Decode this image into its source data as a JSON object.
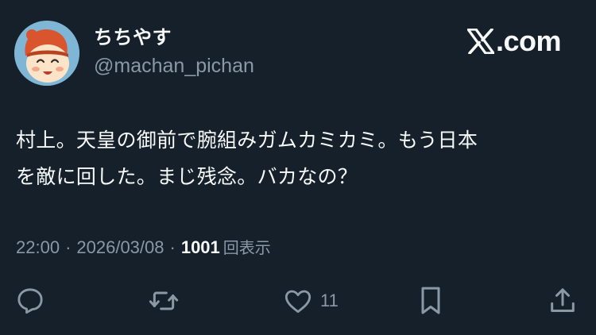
{
  "user": {
    "display_name": "ちちやす",
    "handle": "@machan_pichan",
    "avatar_icon": "cartoon-child-avatar",
    "avatar_bg": "#7fb6d6"
  },
  "brand": {
    "logo_icon": "x-logo",
    "text": ".com"
  },
  "tweet": {
    "text": "村上。天皇の御前で腕組みガムカミカミ。もう日本\nを敵に回した。まじ残念。バカなの？"
  },
  "meta": {
    "time": "22:00",
    "separator": "·",
    "date": "2026/03/08",
    "views_count": "1001",
    "views_label": "回表示"
  },
  "actions": {
    "reply_icon": "reply-icon",
    "retweet_icon": "retweet-icon",
    "like_icon": "heart-icon",
    "like_count": "11",
    "bookmark_icon": "bookmark-icon",
    "share_icon": "share-icon"
  },
  "colors": {
    "background": "#15202b",
    "primary_text": "#f7f9f9",
    "secondary_text": "#8b98a5"
  }
}
